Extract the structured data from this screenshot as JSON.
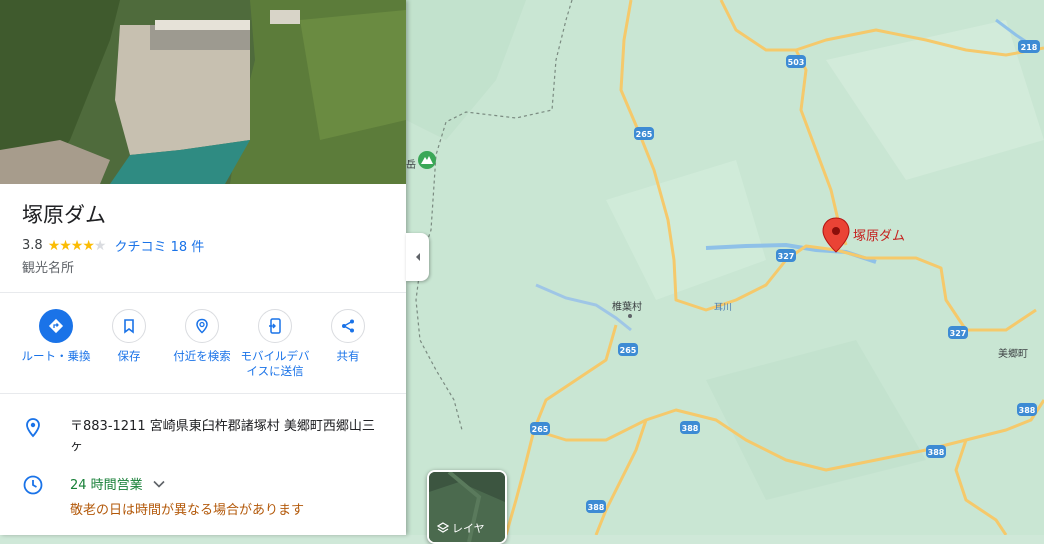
{
  "place": {
    "title": "塚原ダム",
    "rating": "3.8",
    "rating_value": 3.8,
    "reviews_label": "クチコミ 18 件",
    "category": "観光名所"
  },
  "actions": [
    {
      "label": "ルート・乗換",
      "icon": "directions-icon"
    },
    {
      "label": "保存",
      "icon": "bookmark-icon"
    },
    {
      "label": "付近を検索",
      "icon": "nearby-search-icon"
    },
    {
      "label": "モバイルデバイスに送信",
      "icon": "send-to-phone-icon"
    },
    {
      "label": "共有",
      "icon": "share-icon"
    }
  ],
  "info": {
    "address": "〒883-1211 宮崎県東臼杵郡諸塚村 美郷町西郷山三ヶ",
    "hours_status": "24 時間営業",
    "hours_note": "敬老の日は時間が異なる場合があります"
  },
  "map": {
    "marker_label": "塚原ダム",
    "places": {
      "shiibason": "椎葉村",
      "misato": "美郷町",
      "mimikawa": "耳川",
      "peak": "岳"
    },
    "roads": {
      "r503": "503",
      "r218": "218",
      "r265a": "265",
      "r265b": "265",
      "r265c": "265",
      "r327a": "327",
      "r327b": "327",
      "r388a": "388",
      "r388b": "388",
      "r388c": "388",
      "r388d": "388"
    },
    "layer_label": "レイヤ"
  },
  "colors": {
    "accent": "#1a73e8",
    "marker": "#ea4335",
    "open": "#188038",
    "warning": "#b3590a",
    "star": "#fbbc04"
  }
}
